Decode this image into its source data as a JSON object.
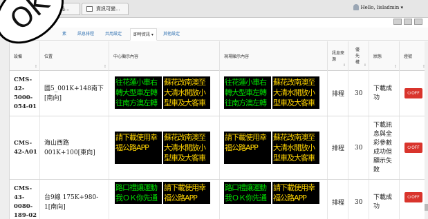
{
  "stamp": {
    "label": "OK"
  },
  "browser": {
    "tabs": [
      {
        "label": "晶..."
      },
      {
        "label": "資訊可變..."
      }
    ],
    "user": "Hello, lisladmin",
    "user_suffix": "▾"
  },
  "nav": {
    "items": [
      {
        "label": "素"
      },
      {
        "label": "訊息排程"
      },
      {
        "label": "共用設定"
      },
      {
        "label": "即時資訊 ▾"
      },
      {
        "label": "其他設定"
      }
    ],
    "active_index": 3
  },
  "table": {
    "headers": [
      "設備",
      "位置",
      "中心顯示內容",
      "現場顯示內容",
      "訊息來源",
      "優先權",
      "狀態",
      "燈號"
    ],
    "sort_glyph": "↕",
    "rows": [
      {
        "device_id": "CMS-42-5000-054-01",
        "location": "國5_001K+148南下[南向]",
        "center": [
          "往花蓮小車右轉大型車左轉往南方澳左轉",
          "蘇花改南澳至大清水開放小型車及大客車"
        ],
        "field": [
          "往花蓮小車右轉大型車左轉往南方澳左轉",
          "蘇花改南澳至大清水開放小型車及大客車"
        ],
        "source": "排程",
        "priority": "30",
        "status": "下載成功",
        "button": "OFF"
      },
      {
        "device_id": "CMS-42-A01",
        "location": "海山西路001K+100[東向]",
        "center": [
          "請下載使用幸福公路APP",
          "蘇花改南澳至大清水開放小型車及大客車"
        ],
        "field": [
          "請下載使用幸福公路APP",
          "蘇花改南澳至大清水開放小型車及大客車"
        ],
        "source": "排程",
        "priority": "30",
        "status": "下載訊息與全彩參數成功但顯示失敗",
        "button": "OFF"
      },
      {
        "device_id": "CMS-43-0080-189-02",
        "location": "台9線 175K+980-1[南向]",
        "center": [
          "路口禮讓運動我ＯＫ你先通",
          "請下載使用幸福公路APP"
        ],
        "field": [
          "路口禮讓運動我ＯＫ你先通",
          "請下載使用幸福公路APP"
        ],
        "source": "排程",
        "priority": "30",
        "status": "下載成功",
        "button": "OFF"
      }
    ]
  },
  "colors": {
    "led_green": "#00e000",
    "led_yellow": "#ffd400",
    "off_button": "#d9342c",
    "link": "#2d6fb0"
  },
  "icons": [
    "tab-page-icon",
    "user-icon",
    "power-icon"
  ]
}
